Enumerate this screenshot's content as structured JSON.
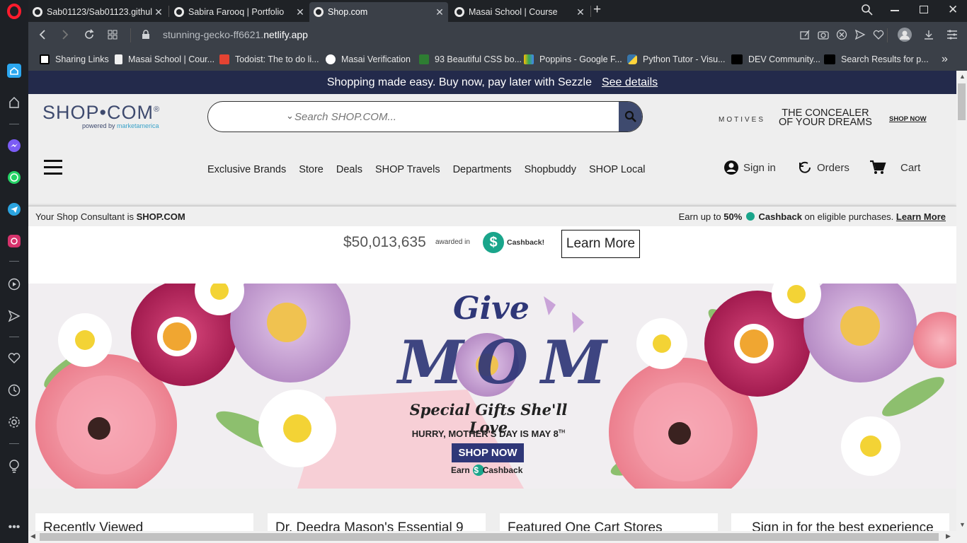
{
  "browser": {
    "tabs": [
      {
        "title": "Sab01123/Sab01123.githul",
        "active": false
      },
      {
        "title": "Sabira Farooq | Portfolio",
        "active": false
      },
      {
        "title": "Shop.com",
        "active": true
      },
      {
        "title": "Masai School | Course",
        "active": false
      }
    ],
    "new_tab_label": "+",
    "url_prefix": "stunning-gecko-ff6621.",
    "url_domain": "netlify.app",
    "bookmarks": [
      {
        "label": "Sharing Links",
        "color": "#ffffff"
      },
      {
        "label": "Masai School | Cour...",
        "color": "#ffffff"
      },
      {
        "label": "Todoist: The to do li...",
        "color": "#e44332"
      },
      {
        "label": "Masai Verification",
        "color": "#ffffff"
      },
      {
        "label": "93 Beautiful CSS bo...",
        "color": "#2e7d32"
      },
      {
        "label": "Poppins - Google F...",
        "color": "#fbbc04"
      },
      {
        "label": "Python Tutor - Visu...",
        "color": "#3776ab"
      },
      {
        "label": "DEV Community...",
        "color": "#000000"
      },
      {
        "label": "Search Results for p...",
        "color": "#000000"
      }
    ],
    "more_bookmarks": "»"
  },
  "promo": {
    "text": "Shopping made easy. Buy now, pay later with Sezzle",
    "link": "See details"
  },
  "header": {
    "logo_text": "SHOP•COM",
    "logo_mark": "®",
    "powered_prefix": "powered by ",
    "powered_brand": "marketamerica",
    "search_placeholder": "Search SHOP.COM...",
    "ad_brand": "MOTIVES",
    "ad_line1": "THE CONCEALER",
    "ad_line2": "OF YOUR DREAMS",
    "ad_cta": "SHOP NOW"
  },
  "nav": {
    "items": [
      "Exclusive Brands",
      "Store",
      "Deals",
      "SHOP Travels",
      "Departments",
      "Shopbuddy",
      "SHOP Local"
    ],
    "sign_in": "Sign in",
    "orders": "Orders",
    "cart": "Cart"
  },
  "consultant": {
    "prefix": "Your Shop Consultant is ",
    "name": "SHOP.COM",
    "earn_prefix": "Earn up to ",
    "earn_pct": "50%",
    "earn_cashback": "Cashback",
    "earn_suffix": " on eligible purchases. ",
    "learn_more": "Learn More"
  },
  "cashback": {
    "amount": "$50,013,635",
    "awarded": "awarded in",
    "symbol": "$",
    "label": "Cashback!",
    "button": "Learn More"
  },
  "banner": {
    "give": "Give",
    "mom": "MOM",
    "tagline": "Special Gifts She'll Love",
    "hurry": "HURRY, MOTHER'S DAY IS MAY 8",
    "hurry_sup": "TH",
    "cta": "SHOP NOW",
    "earn": "Earn",
    "earn_symbol": "$",
    "earn_label": "Cashback"
  },
  "cards": [
    "Recently Viewed",
    "Dr. Deedra Mason's Essential 9",
    "Featured One Cart Stores",
    "Sign in for the best experience"
  ],
  "colors": {
    "promo_bg": "#232a4b",
    "brand_navy": "#3e4a6e",
    "cashback_green": "#1aa58b",
    "browser_dark": "#1f2226",
    "browser_bar": "#3b4048"
  }
}
